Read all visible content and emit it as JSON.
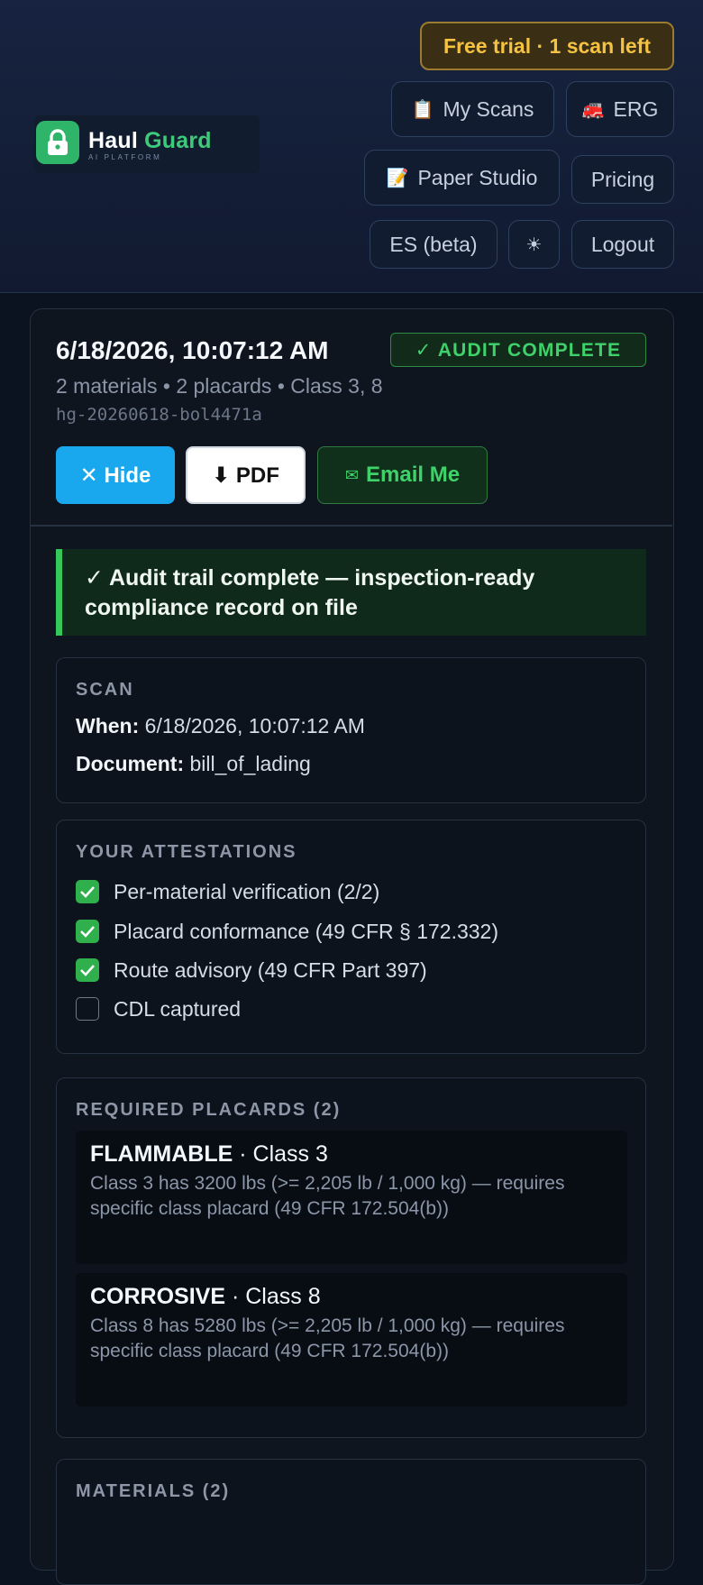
{
  "header": {
    "logo": {
      "name_part1": "Haul",
      "name_part2": "Guard",
      "subtitle": "AI PLATFORM",
      "icon": "lock-icon"
    },
    "trial_badge": "Free trial · 1 scan left",
    "nav": [
      {
        "label": "My Scans",
        "icon": "clipboard-icon",
        "glyph": "📋"
      },
      {
        "label": "ERG",
        "icon": "fire-truck-icon",
        "glyph": "🚒"
      },
      {
        "label": "Paper Studio",
        "icon": "memo-icon",
        "glyph": "📝"
      },
      {
        "label": "Pricing"
      },
      {
        "label": "ES (beta)"
      },
      {
        "label": "☀",
        "icon": "sun-icon"
      },
      {
        "label": "Logout"
      }
    ]
  },
  "scan_card": {
    "datetime": "6/18/2026, 10:07:12 AM",
    "status_badge": "✓ AUDIT COMPLETE",
    "meta": "2 materials • 2 placards • Class 3, 8",
    "scan_id": "hg-20260618-bol4471a",
    "actions": {
      "hide": "✕ Hide",
      "pdf": "⬇ PDF",
      "email_icon": "✉",
      "email": "Email Me"
    },
    "banner": "✓ Audit trail complete — inspection-ready compliance record on file",
    "scan_section": {
      "title": "SCAN",
      "when_label": "When:",
      "when_value": "6/18/2026, 10:07:12 AM",
      "document_label": "Document:",
      "document_value": "bill_of_lading"
    },
    "attestations": {
      "title": "YOUR ATTESTATIONS",
      "items": [
        {
          "label": "Per-material verification (2/2)",
          "checked": true
        },
        {
          "label": "Placard conformance (49 CFR § 172.332)",
          "checked": true
        },
        {
          "label": "Route advisory (49 CFR Part 397)",
          "checked": true
        },
        {
          "label": "CDL captured",
          "checked": false
        }
      ]
    },
    "placards": {
      "title": "REQUIRED PLACARDS (2)",
      "items": [
        {
          "name": "FLAMMABLE",
          "class": "· Class 3",
          "desc": "Class 3 has 3200 lbs (>= 2,205 lb / 1,000 kg) — requires specific class placard (49 CFR 172.504(b))"
        },
        {
          "name": "CORROSIVE",
          "class": "· Class 8",
          "desc": "Class 8 has 5280 lbs (>= 2,205 lb / 1,000 kg) — requires specific class placard (49 CFR 172.504(b))"
        }
      ]
    },
    "materials": {
      "title": "MATERIALS (2)"
    }
  }
}
